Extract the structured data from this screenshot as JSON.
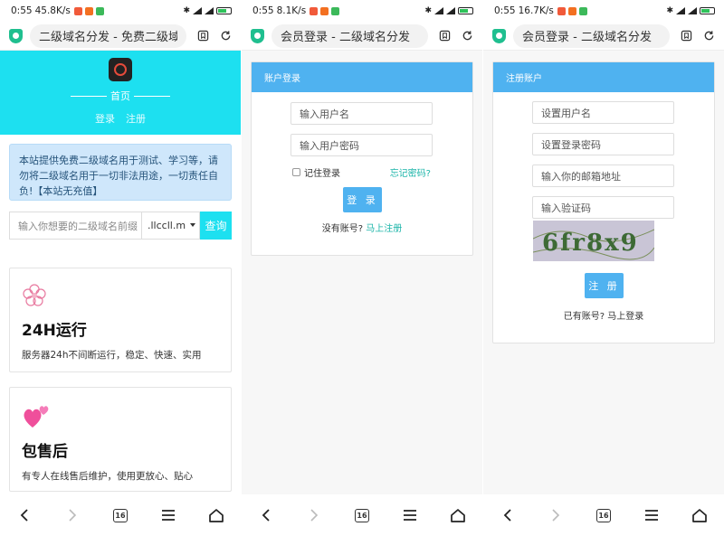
{
  "panels": [
    {
      "status": {
        "time": "0:55",
        "speed": "45.8K/s"
      },
      "urlbar": {
        "title": "二级域名分发 - 免费二级域名注"
      },
      "hero": {
        "home": "首页",
        "login": "登录",
        "register": "注册"
      },
      "notice": {
        "text": "本站提供免费二级域名用于测试、学习等，请勿将二级域名用于一切非法用途，一切责任自负!【本站无充值】"
      },
      "search": {
        "placeholder": "输入你想要的二级域名前缀",
        "suffix": ".llccll.m",
        "button": "查询"
      },
      "features": [
        {
          "icon": "flower-icon",
          "title": "24H运行",
          "desc": "服务器24h不间断运行，稳定、快速、实用"
        },
        {
          "icon": "hearts-icon",
          "title": "包售后",
          "desc": "有专人在线售后维护，使用更放心、贴心"
        }
      ]
    },
    {
      "status": {
        "time": "0:55",
        "speed": "8.1K/s"
      },
      "urlbar": {
        "title": "会员登录 - 二级域名分发"
      },
      "login": {
        "header": "账户登录",
        "username_placeholder": "输入用户名",
        "password_placeholder": "输入用户密码",
        "remember": "记住登录",
        "forgot": "忘记密码?",
        "submit": "登 录",
        "no_account": "没有账号?",
        "register_link": "马上注册"
      }
    },
    {
      "status": {
        "time": "0:55",
        "speed": "16.7K/s"
      },
      "urlbar": {
        "title": "会员登录 - 二级域名分发"
      },
      "register": {
        "header": "注册账户",
        "username_placeholder": "设置用户名",
        "password_placeholder": "设置登录密码",
        "email_placeholder": "输入你的邮箱地址",
        "captcha_placeholder": "输入验证码",
        "captcha_text": "6fr8x9",
        "submit": "注 册",
        "has_account": "已有账号?",
        "login_link": "马上登录"
      }
    }
  ],
  "bottomnav": {
    "tab_count": "16"
  },
  "colors": {
    "accent": "#1de0f0",
    "button": "#4fb2f0",
    "link": "#1cb5a9",
    "notice_bg": "#cfe7fb"
  }
}
